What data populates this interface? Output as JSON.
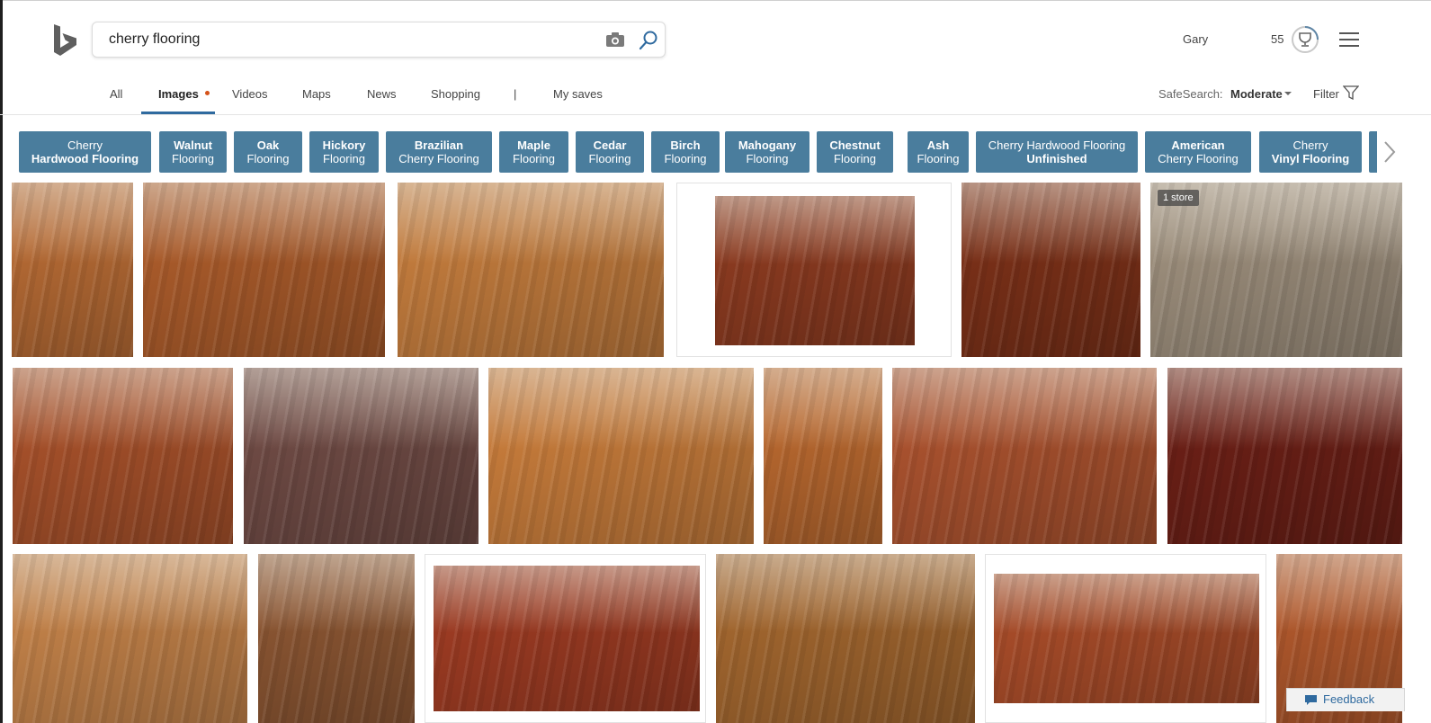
{
  "search": {
    "query": "cherry flooring"
  },
  "header": {
    "user_name": "Gary",
    "rewards_points": "55"
  },
  "tabs": [
    {
      "label": "All"
    },
    {
      "label": "Images"
    },
    {
      "label": "Videos"
    },
    {
      "label": "Maps"
    },
    {
      "label": "News"
    },
    {
      "label": "Shopping"
    },
    {
      "label": "|"
    },
    {
      "label": "My saves"
    }
  ],
  "toolbar": {
    "safesearch_label": "SafeSearch:",
    "safesearch_value": "Moderate",
    "filter_label": "Filter"
  },
  "related": [
    {
      "line1": "Cherry",
      "line2": "Hardwood Flooring",
      "bold": 2
    },
    {
      "line1": "Walnut",
      "line2": "Flooring",
      "bold": 1
    },
    {
      "line1": "Oak",
      "line2": "Flooring",
      "bold": 1
    },
    {
      "line1": "Hickory",
      "line2": "Flooring",
      "bold": 1
    },
    {
      "line1": "Brazilian",
      "line2": "Cherry Flooring",
      "bold": 1
    },
    {
      "line1": "Maple",
      "line2": "Flooring",
      "bold": 1
    },
    {
      "line1": "Cedar",
      "line2": "Flooring",
      "bold": 1
    },
    {
      "line1": "Birch",
      "line2": "Flooring",
      "bold": 1
    },
    {
      "line1": "Mahogany",
      "line2": "Flooring",
      "bold": 1
    },
    {
      "line1": "Chestnut",
      "line2": "Flooring",
      "bold": 1
    },
    {
      "line1": "Ash",
      "line2": "Flooring",
      "bold": 1
    },
    {
      "line1": "Cherry Hardwood Flooring",
      "line2": "Unfinished",
      "bold": 2
    },
    {
      "line1": "American",
      "line2": "Cherry Flooring",
      "bold": 1
    },
    {
      "line1": "Cherry",
      "line2": "Vinyl Flooring",
      "bold": 2
    }
  ],
  "results": {
    "badge_text": "1 store",
    "tones": [
      "#b56a34",
      "#a85a2a",
      "#c07a3c",
      "#8a3a20",
      "#7a3018",
      "#9a8c7a",
      "#a5502a",
      "#6e4a44",
      "#c47a3a",
      "#b8682f",
      "#a8512e",
      "#6a1f16",
      "#c08048",
      "#8a5532",
      "#9a3a22",
      "#a0652e",
      "#a44a28",
      "#b0582c"
    ]
  },
  "feedback": {
    "label": "Feedback"
  }
}
